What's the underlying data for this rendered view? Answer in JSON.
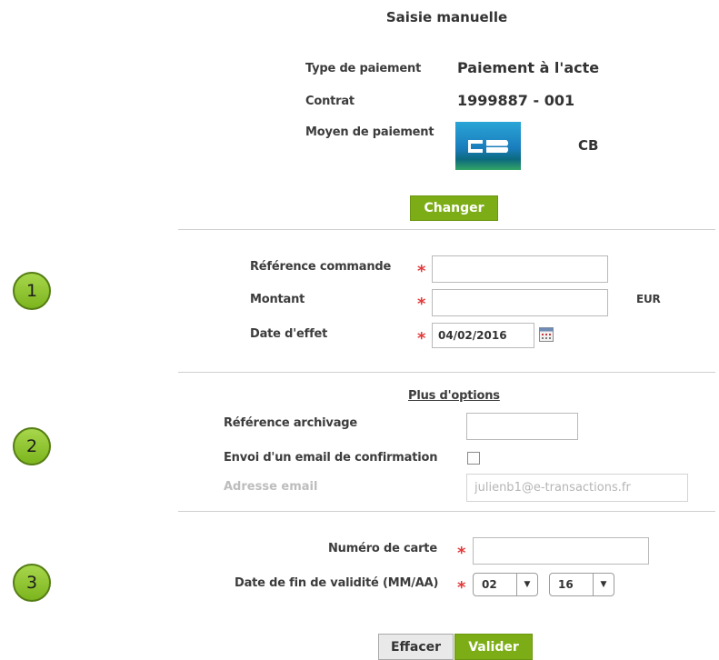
{
  "header": {
    "title": "Saisie manuelle"
  },
  "summary": {
    "type_label": "Type de paiement",
    "type_value": "Paiement à l'acte",
    "contract_label": "Contrat",
    "contract_value": "1999887 - 001",
    "payment_means_label": "Moyen de paiement",
    "payment_means_value": "CB",
    "change_button": "Changer"
  },
  "steps": [
    "1",
    "2",
    "3"
  ],
  "order": {
    "reference_label": "Référence commande",
    "reference_value": "",
    "amount_label": "Montant",
    "amount_value": "",
    "currency": "EUR",
    "date_label": "Date d'effet",
    "date_value": "04/02/2016",
    "required_mark": "*"
  },
  "options": {
    "title": "Plus d'options",
    "archive_label": "Référence archivage",
    "archive_value": "",
    "email_confirm_label": "Envoi d'un email de confirmation",
    "email_confirm_checked": false,
    "email_label": "Adresse email",
    "email_value": "julienb1@e-transactions.fr"
  },
  "card": {
    "number_label": "Numéro de carte",
    "number_value": "",
    "expiry_label": "Date de fin de validité (MM/AA)",
    "expiry_month": "02",
    "expiry_year": "16"
  },
  "actions": {
    "clear": "Effacer",
    "submit": "Valider"
  },
  "colors": {
    "accent_green": "#7cad16",
    "required_red": "#e23a3a",
    "step_green": "#8fc63a"
  }
}
